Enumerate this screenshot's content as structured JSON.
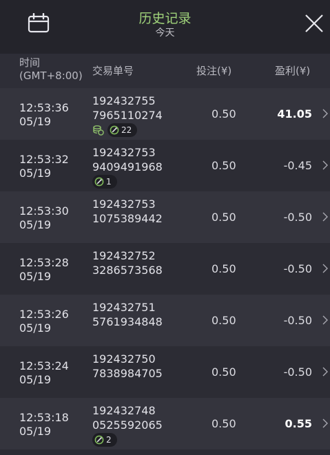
{
  "header": {
    "title": "历史记录",
    "subtitle": "今天"
  },
  "columns": {
    "time_line1": "时间",
    "time_line2": "(GMT+8:00)",
    "order": "交易单号",
    "bet": "投注(¥)",
    "profit": "盈利(¥)"
  },
  "rows": [
    {
      "time": "12:53:36",
      "date": "05/19",
      "order1": "192432755",
      "order2": "7965110274",
      "bet": "0.50",
      "profit": "41.05",
      "win": true,
      "coin": true,
      "tag": "22"
    },
    {
      "time": "12:53:32",
      "date": "05/19",
      "order1": "192432753",
      "order2": "9409491968",
      "bet": "0.50",
      "profit": "-0.45",
      "win": false,
      "coin": false,
      "tag": "1"
    },
    {
      "time": "12:53:30",
      "date": "05/19",
      "order1": "192432753",
      "order2": "1075389442",
      "bet": "0.50",
      "profit": "-0.50",
      "win": false,
      "coin": false,
      "tag": null
    },
    {
      "time": "12:53:28",
      "date": "05/19",
      "order1": "192432752",
      "order2": "3286573568",
      "bet": "0.50",
      "profit": "-0.50",
      "win": false,
      "coin": false,
      "tag": null
    },
    {
      "time": "12:53:26",
      "date": "05/19",
      "order1": "192432751",
      "order2": "5761934848",
      "bet": "0.50",
      "profit": "-0.50",
      "win": false,
      "coin": false,
      "tag": null
    },
    {
      "time": "12:53:24",
      "date": "05/19",
      "order1": "192432750",
      "order2": "7838984705",
      "bet": "0.50",
      "profit": "-0.50",
      "win": false,
      "coin": false,
      "tag": null
    },
    {
      "time": "12:53:18",
      "date": "05/19",
      "order1": "192432748",
      "order2": "0525592065",
      "bet": "0.50",
      "profit": "0.55",
      "win": true,
      "coin": false,
      "tag": "2"
    }
  ],
  "colors": {
    "accent": "#9fd27a",
    "coin": "#8fc06a",
    "tag_ring": "#7fb85a"
  },
  "icons": {
    "calendar": "calendar-icon",
    "close": "close-icon",
    "row_arrow": "chevron-right-icon",
    "coin": "coin-stack-icon",
    "spin": "spin-icon"
  }
}
